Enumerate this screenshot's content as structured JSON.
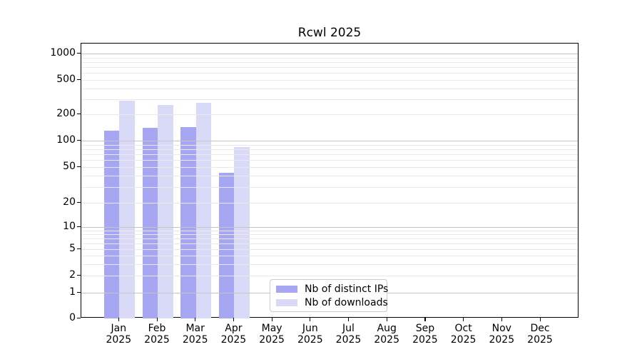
{
  "chart_data": {
    "type": "bar",
    "title": "Rcwl 2025",
    "categories": [
      "Jan",
      "Feb",
      "Mar",
      "Apr",
      "May",
      "Jun",
      "Jul",
      "Aug",
      "Sep",
      "Oct",
      "Nov",
      "Dec"
    ],
    "year_label": "2025",
    "series": [
      {
        "name": "Nb of distinct IPs",
        "color": "#a6a6f2",
        "values": [
          130,
          140,
          142,
          43,
          null,
          null,
          null,
          null,
          null,
          null,
          null,
          null
        ]
      },
      {
        "name": "Nb of downloads",
        "color": "#d9d9f8",
        "values": [
          290,
          255,
          270,
          84,
          null,
          null,
          null,
          null,
          null,
          null,
          null,
          null
        ]
      }
    ],
    "y_ticks": [
      0,
      1,
      2,
      5,
      10,
      20,
      50,
      100,
      200,
      500,
      1000
    ],
    "y_scale": "log-like with zero baseline",
    "ylim": [
      0,
      1300
    ],
    "xlabel": "",
    "ylabel": "",
    "grid": true,
    "grid_major_at": [
      1,
      10,
      100,
      1000
    ],
    "legend_position": "lower center",
    "colors": {
      "major_grid": "#c4c4c4",
      "minor_grid": "#e9e9e9",
      "axis": "#000000",
      "background": "#ffffff"
    }
  }
}
